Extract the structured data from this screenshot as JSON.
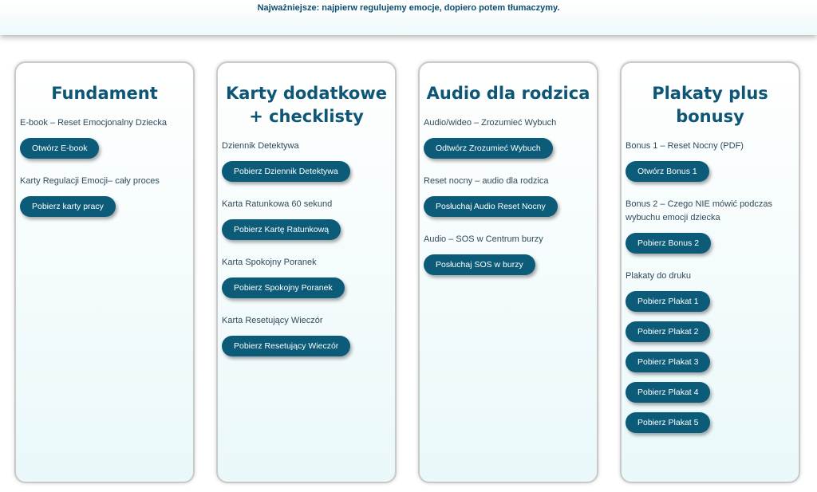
{
  "banner": {
    "note": "Najważniejsze: najpierw regulujemy emocje, dopiero potem tłumaczymy."
  },
  "columns": [
    {
      "title": "Fundament",
      "items": [
        {
          "label": "E-book – Reset Emocjonalny Dziecka",
          "button": "Otwórz E-book"
        },
        {
          "label": "Karty Regulacji Emocji– cały proces",
          "button": "Pobierz karty pracy"
        }
      ]
    },
    {
      "title": "Karty dodatkowe + checklisty",
      "items": [
        {
          "label": "Dziennik Detektywa",
          "button": "Pobierz Dziennik Detektywa"
        },
        {
          "label": "Karta Ratunkowa 60 sekund",
          "button": "Pobierz Kartę Ratunkową"
        },
        {
          "label": "Karta Spokojny Poranek",
          "button": "Pobierz Spokojny Poranek"
        },
        {
          "label": "Karta Resetujący Wieczór",
          "button": "Pobierz Resetujący Wieczór"
        }
      ]
    },
    {
      "title": "Audio dla rodzica",
      "items": [
        {
          "label": "Audio/wideo  – Zrozumieć Wybuch",
          "button": "Odtwórz Zrozumieć Wybuch"
        },
        {
          "label": "Reset nocny – audio dla rodzica",
          "button": "Posłuchaj Audio Reset Nocny"
        },
        {
          "label": "Audio – SOS w Centrum burzy",
          "button": "Posłuchaj SOS w burzy"
        }
      ]
    },
    {
      "title": "Plakaty plus bonusy",
      "items": [
        {
          "label": "Bonus 1 – Reset Nocny (PDF)",
          "button": "Otwórz Bonus 1"
        },
        {
          "label": "Bonus 2 – Czego NIE mówić podczas wybuchu emocji dziecka",
          "button": "Pobierz Bonus 2"
        },
        {
          "label": "Plakaty do druku",
          "buttons": [
            "Pobierz Plakat 1",
            "Pobierz Plakat 2",
            "Pobierz Plakat 3",
            "Pobierz Plakat 4",
            "Pobierz Plakat 5"
          ]
        }
      ]
    }
  ]
}
